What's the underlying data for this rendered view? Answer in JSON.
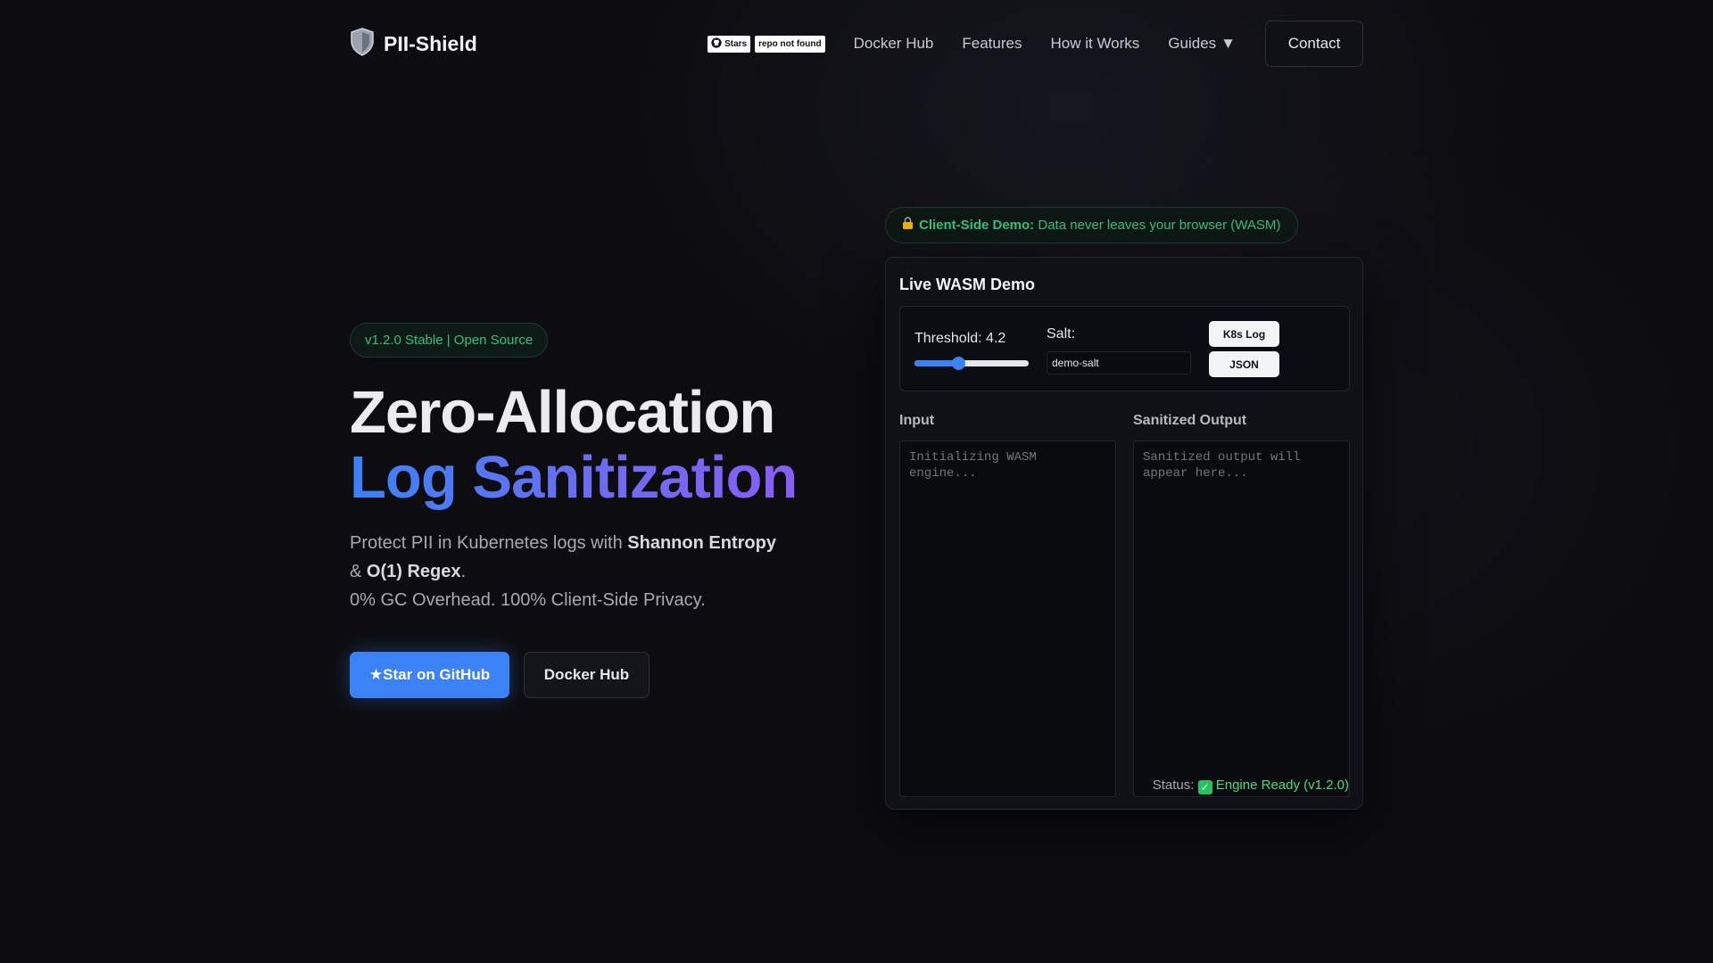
{
  "brand": {
    "name": "PII-Shield",
    "logo_icon": "shield-icon"
  },
  "nav": {
    "stars_badge": "Stars",
    "repo_badge": "repo not found",
    "links": [
      "Docker Hub",
      "Features",
      "How it Works"
    ],
    "guides_label": "Guides",
    "guides_caret": "▼",
    "contact_label": "Contact"
  },
  "hero": {
    "version_badge": "v1.2.0 Stable | Open Source",
    "title_line1": "Zero-Allocation",
    "title_line2": "Log Sanitization",
    "desc_prefix": "Protect PII in Kubernetes logs with ",
    "desc_bold1": "Shannon Entropy",
    "desc_amp": " & ",
    "desc_bold2": "O(1) Regex",
    "desc_period": ".",
    "desc_line3": "0% GC Overhead. 100% Client-Side Privacy.",
    "cta_star": "★Star on GitHub",
    "cta_docker": "Docker Hub"
  },
  "demo": {
    "client_pill_bold": "Client-Side Demo:",
    "client_pill_text": " Data never leaves your browser (WASM)",
    "title": "Live WASM Demo",
    "threshold_label": "Threshold: 4.2",
    "threshold_fraction": 0.38,
    "salt_label": "Salt:",
    "salt_value": "demo-salt",
    "btn_k8s": "K8s Log",
    "btn_json": "JSON",
    "input_label": "Input",
    "input_placeholder": "Initializing WASM engine...",
    "output_label": "Sanitized Output",
    "output_placeholder": "Sanitized output will appear here...",
    "status_prefix": "Status: ",
    "status_check": "✓",
    "status_value": " Engine Ready (v1.2.0)"
  },
  "colors": {
    "accent": "#3b82f6",
    "green": "#34c27a",
    "background": "#0d0d11"
  }
}
